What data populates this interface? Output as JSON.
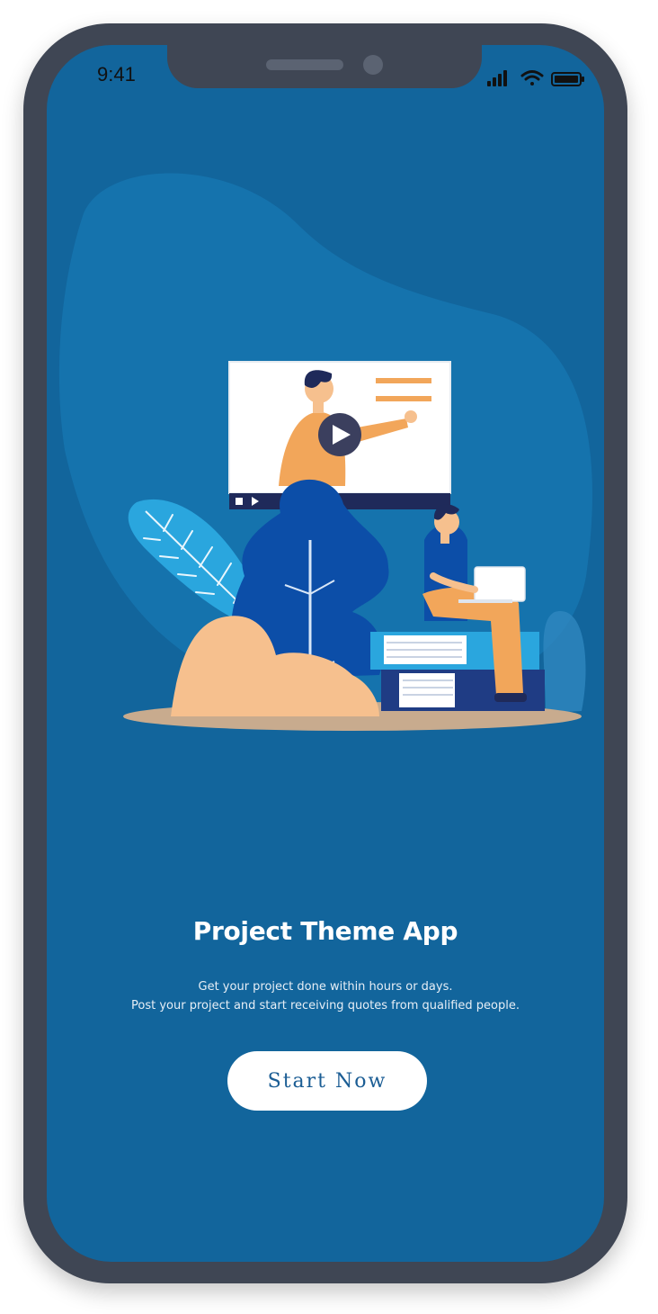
{
  "status_bar": {
    "time": "9:41",
    "icons": [
      "signal-icon",
      "wifi-icon",
      "battery-icon"
    ]
  },
  "onboarding": {
    "title": "Project Theme App",
    "description_line1": "Get your project done within hours or days.",
    "description_line2": "Post your project and start receiving quotes from qualified people.",
    "start_button_label": "Start Now"
  },
  "colors": {
    "screen_background": "#12659c",
    "phone_frame": "#3f4654",
    "button_background": "#ffffff",
    "button_text": "#1b5d94",
    "accent_orange": "#f2a65a",
    "accent_peach": "#f6c08e"
  }
}
